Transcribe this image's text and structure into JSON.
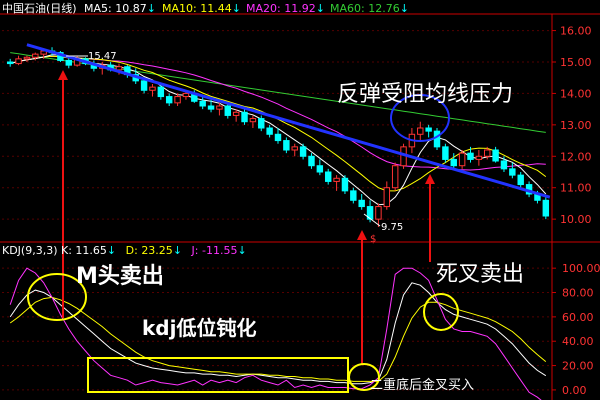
{
  "header": {
    "title": "中国石油(日线)",
    "ma_items": [
      {
        "label": "MA5: 10.87",
        "arrow": "↓",
        "color": "#ffffff"
      },
      {
        "label": "MA10: 11.44",
        "arrow": "↓",
        "color": "#ffff00"
      },
      {
        "label": "MA20: 11.92",
        "arrow": "↓",
        "color": "#ff33ff"
      },
      {
        "label": "MA60: 12.76",
        "arrow": "↓",
        "color": "#33cc33"
      }
    ]
  },
  "kdj_header": {
    "name": "KDJ(9,3,3)",
    "k": "K: 11.65",
    "k_arrow": "↓",
    "d": "D: 23.25",
    "d_arrow": "↓",
    "j": "J: -11.55",
    "j_arrow": "↓"
  },
  "annotations": {
    "resistance": "反弹受阻均线压力",
    "m_top": "M头卖出",
    "kdj_low": "kdj低位钝化",
    "death_cross": "死叉卖出",
    "golden_cross": "二重底后金叉买入",
    "high_price": "15.47",
    "low_price": "9.75",
    "s_marker": "$"
  },
  "colors": {
    "background": "#000000",
    "axis": "#cc0000",
    "up": "#ff3333",
    "down": "#00ffff",
    "trendline": "#2233ff",
    "circle": "#ffff00",
    "arrow": "#ee1111"
  },
  "chart_data": [
    {
      "type": "candlestick",
      "title": "中国石油(日线)",
      "y_ticks": [
        "16.00",
        "15.00",
        "14.00",
        "13.00",
        "12.00",
        "11.00",
        "10.00"
      ],
      "ylim": [
        9.4,
        16.4
      ],
      "candles_ohlc": [
        [
          15.0,
          15.1,
          14.85,
          14.95
        ],
        [
          14.95,
          15.2,
          14.9,
          15.1
        ],
        [
          15.1,
          15.2,
          15.0,
          15.15
        ],
        [
          15.15,
          15.3,
          15.05,
          15.25
        ],
        [
          15.25,
          15.4,
          15.1,
          15.35
        ],
        [
          15.35,
          15.47,
          15.2,
          15.3
        ],
        [
          15.3,
          15.35,
          15.0,
          15.05
        ],
        [
          15.05,
          15.15,
          14.8,
          14.9
        ],
        [
          14.9,
          15.2,
          14.85,
          15.1
        ],
        [
          15.1,
          15.15,
          14.9,
          14.95
        ],
        [
          14.95,
          15.05,
          14.7,
          14.8
        ],
        [
          14.8,
          15.0,
          14.6,
          14.9
        ],
        [
          14.9,
          15.0,
          14.7,
          14.75
        ],
        [
          14.75,
          14.95,
          14.6,
          14.85
        ],
        [
          14.85,
          14.9,
          14.5,
          14.6
        ],
        [
          14.6,
          14.8,
          14.3,
          14.4
        ],
        [
          14.4,
          14.5,
          14.0,
          14.1
        ],
        [
          14.1,
          14.3,
          13.9,
          14.2
        ],
        [
          14.2,
          14.3,
          13.8,
          13.9
        ],
        [
          13.9,
          14.0,
          13.6,
          13.7
        ],
        [
          13.7,
          14.0,
          13.6,
          13.9
        ],
        [
          13.9,
          14.1,
          13.8,
          14.0
        ],
        [
          14.0,
          14.1,
          13.7,
          13.75
        ],
        [
          13.75,
          13.9,
          13.5,
          13.6
        ],
        [
          13.6,
          13.8,
          13.4,
          13.5
        ],
        [
          13.5,
          13.7,
          13.3,
          13.6
        ],
        [
          13.6,
          13.7,
          13.2,
          13.3
        ],
        [
          13.3,
          13.5,
          13.1,
          13.4
        ],
        [
          13.4,
          13.5,
          13.0,
          13.1
        ],
        [
          13.1,
          13.3,
          12.9,
          13.2
        ],
        [
          13.2,
          13.3,
          12.8,
          12.9
        ],
        [
          12.9,
          13.0,
          12.6,
          12.7
        ],
        [
          12.7,
          12.9,
          12.4,
          12.5
        ],
        [
          12.5,
          12.6,
          12.1,
          12.2
        ],
        [
          12.2,
          12.4,
          12.0,
          12.3
        ],
        [
          12.3,
          12.4,
          11.9,
          12.0
        ],
        [
          12.0,
          12.1,
          11.6,
          11.7
        ],
        [
          11.7,
          11.9,
          11.4,
          11.5
        ],
        [
          11.5,
          11.6,
          11.1,
          11.2
        ],
        [
          11.2,
          11.4,
          10.9,
          11.3
        ],
        [
          11.3,
          11.4,
          10.8,
          10.9
        ],
        [
          10.9,
          11.0,
          10.5,
          10.6
        ],
        [
          10.6,
          10.8,
          10.3,
          10.4
        ],
        [
          10.4,
          10.6,
          9.9,
          10.0
        ],
        [
          10.0,
          10.5,
          9.75,
          10.4
        ],
        [
          10.4,
          11.2,
          10.3,
          11.0
        ],
        [
          11.0,
          11.8,
          10.9,
          11.7
        ],
        [
          11.7,
          12.4,
          11.6,
          12.3
        ],
        [
          12.3,
          12.9,
          12.1,
          12.7
        ],
        [
          12.7,
          13.1,
          12.5,
          12.9
        ],
        [
          12.9,
          13.0,
          12.6,
          12.8
        ],
        [
          12.8,
          12.9,
          12.2,
          12.3
        ],
        [
          12.3,
          12.4,
          11.8,
          11.9
        ],
        [
          11.9,
          12.1,
          11.6,
          11.7
        ],
        [
          11.7,
          12.2,
          11.6,
          12.1
        ],
        [
          12.1,
          12.3,
          11.8,
          11.9
        ],
        [
          11.9,
          12.2,
          11.7,
          12.0
        ],
        [
          12.0,
          12.3,
          11.9,
          12.2
        ],
        [
          12.2,
          12.3,
          11.8,
          11.85
        ],
        [
          11.85,
          12.0,
          11.5,
          11.6
        ],
        [
          11.6,
          11.8,
          11.3,
          11.4
        ],
        [
          11.4,
          11.5,
          11.0,
          11.1
        ],
        [
          11.1,
          11.2,
          10.7,
          10.8
        ],
        [
          10.8,
          10.9,
          10.5,
          10.6
        ],
        [
          10.6,
          10.7,
          10.0,
          10.1
        ]
      ]
    },
    {
      "type": "line",
      "title": "KDJ(9,3,3)",
      "y_ticks": [
        "100.00",
        "80.00",
        "60.00",
        "40.00",
        "20.00",
        "0.00"
      ],
      "ylim": [
        -5,
        110
      ],
      "series": [
        {
          "name": "K",
          "color": "#ffffff",
          "values": [
            60,
            70,
            78,
            82,
            80,
            76,
            70,
            64,
            58,
            52,
            46,
            40,
            34,
            30,
            26,
            22,
            20,
            18,
            17,
            16,
            15,
            14,
            14,
            13,
            13,
            12,
            12,
            11,
            12,
            13,
            12,
            11,
            10,
            10,
            9,
            8,
            8,
            7,
            7,
            6,
            6,
            5,
            5,
            6,
            8,
            25,
            55,
            78,
            88,
            86,
            80,
            72,
            66,
            62,
            60,
            58,
            56,
            54,
            50,
            44,
            38,
            30,
            22,
            16,
            11.65
          ]
        },
        {
          "name": "D",
          "color": "#ffff00",
          "values": [
            55,
            60,
            66,
            72,
            75,
            76,
            74,
            71,
            67,
            62,
            57,
            52,
            46,
            41,
            36,
            31,
            27,
            24,
            22,
            20,
            19,
            18,
            17,
            16,
            15,
            15,
            14,
            13,
            13,
            13,
            13,
            12,
            12,
            11,
            11,
            10,
            10,
            9,
            9,
            8,
            8,
            7,
            7,
            7,
            7,
            13,
            27,
            44,
            59,
            68,
            72,
            72,
            70,
            67,
            65,
            63,
            61,
            59,
            56,
            52,
            48,
            42,
            35,
            29,
            23.25
          ]
        },
        {
          "name": "J",
          "color": "#ff33ff",
          "values": [
            70,
            90,
            100,
            96,
            88,
            76,
            62,
            50,
            40,
            32,
            24,
            18,
            12,
            10,
            8,
            4,
            6,
            8,
            6,
            5,
            4,
            6,
            8,
            4,
            8,
            6,
            8,
            6,
            10,
            12,
            8,
            6,
            4,
            8,
            2,
            4,
            2,
            4,
            2,
            2,
            2,
            1,
            1,
            4,
            10,
            50,
            95,
            100,
            100,
            96,
            90,
            74,
            58,
            50,
            48,
            48,
            46,
            44,
            38,
            28,
            18,
            8,
            -2,
            -6,
            -11.55
          ]
        }
      ]
    }
  ]
}
